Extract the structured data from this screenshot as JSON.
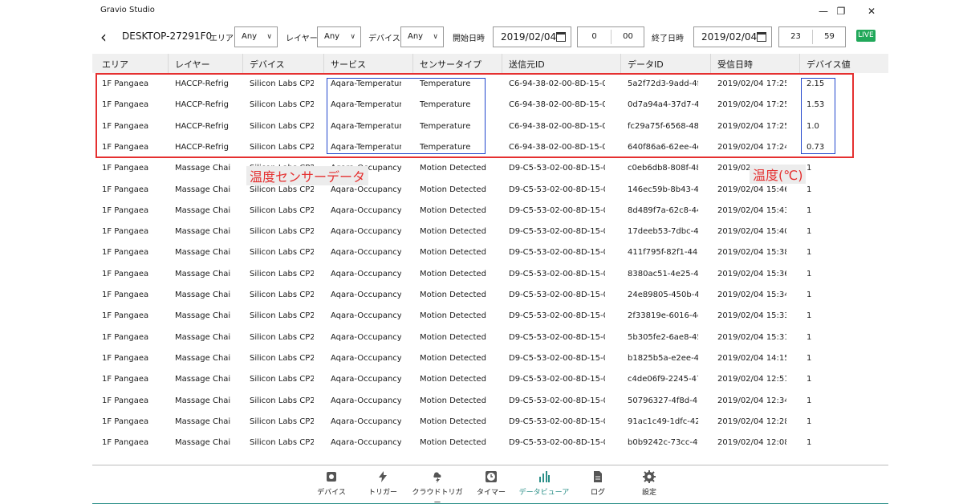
{
  "app": {
    "title": "Gravio Studio"
  },
  "toolbar": {
    "device_name": "DESKTOP-27291F0",
    "area_label": "エリア",
    "area_value": "Any",
    "layer_label": "レイヤー",
    "layer_value": "Any",
    "device_label": "デバイス",
    "device_value": "Any",
    "start_label": "開始日時",
    "start_date": "2019/02/04",
    "start_hour": "0",
    "start_minute": "00",
    "end_label": "終了日時",
    "end_date": "2019/02/04",
    "end_hour": "23",
    "end_minute": "59",
    "live_label": "LIVE"
  },
  "table": {
    "headers": [
      "エリア",
      "レイヤー",
      "デバイス",
      "サービス",
      "センサータイプ",
      "送信元ID",
      "データID",
      "受信日時",
      "デバイス値"
    ],
    "rows": [
      [
        "1F Pangaea",
        "HACCP-Refrig",
        "Silicon Labs CP2",
        "Aqara-Temperatur",
        "Temperature",
        "C6-94-38-02-00-8D-15-0(",
        "5a2f72d3-9add-4f",
        "2019/02/04 17:25:",
        "2.15"
      ],
      [
        "1F Pangaea",
        "HACCP-Refrig",
        "Silicon Labs CP2",
        "Aqara-Temperatur",
        "Temperature",
        "C6-94-38-02-00-8D-15-0(",
        "0d7a94a4-37d7-4",
        "2019/02/04 17:25:",
        "1.53"
      ],
      [
        "1F Pangaea",
        "HACCP-Refrig",
        "Silicon Labs CP2",
        "Aqara-Temperatur",
        "Temperature",
        "C6-94-38-02-00-8D-15-0(",
        "fc29a75f-6568-48",
        "2019/02/04 17:25:",
        "1.0"
      ],
      [
        "1F Pangaea",
        "HACCP-Refrig",
        "Silicon Labs CP2",
        "Aqara-Temperatur",
        "Temperature",
        "C6-94-38-02-00-8D-15-0(",
        "640f86a6-62ee-4e",
        "2019/02/04 17:24:",
        "0.73"
      ],
      [
        "1F Pangaea",
        "Massage Chai",
        "Silicon Labs CP2",
        "Aqara-Occupancy",
        "Motion Detected",
        "D9-C5-53-02-00-8D-15-0",
        "c0eb6db8-808f-48",
        "2019/02/0",
        "1"
      ],
      [
        "1F Pangaea",
        "Massage Chai",
        "Silicon Labs CP2",
        "Aqara-Occupancy",
        "Motion Detected",
        "D9-C5-53-02-00-8D-15-0",
        "146ec59b-8b43-4",
        "2019/02/04 15:46:",
        "1"
      ],
      [
        "1F Pangaea",
        "Massage Chai",
        "Silicon Labs CP2",
        "Aqara-Occupancy",
        "Motion Detected",
        "D9-C5-53-02-00-8D-15-0",
        "8d489f7a-62c8-44",
        "2019/02/04 15:43:",
        "1"
      ],
      [
        "1F Pangaea",
        "Massage Chai",
        "Silicon Labs CP2",
        "Aqara-Occupancy",
        "Motion Detected",
        "D9-C5-53-02-00-8D-15-0",
        "17deeb53-7dbc-4",
        "2019/02/04 15:40:",
        "1"
      ],
      [
        "1F Pangaea",
        "Massage Chai",
        "Silicon Labs CP2",
        "Aqara-Occupancy",
        "Motion Detected",
        "D9-C5-53-02-00-8D-15-0",
        "411f795f-82f1-44",
        "2019/02/04 15:38:",
        "1"
      ],
      [
        "1F Pangaea",
        "Massage Chai",
        "Silicon Labs CP2",
        "Aqara-Occupancy",
        "Motion Detected",
        "D9-C5-53-02-00-8D-15-0",
        "8380ac51-4e25-4f",
        "2019/02/04 15:36:",
        "1"
      ],
      [
        "1F Pangaea",
        "Massage Chai",
        "Silicon Labs CP2",
        "Aqara-Occupancy",
        "Motion Detected",
        "D9-C5-53-02-00-8D-15-0",
        "24e89805-450b-4",
        "2019/02/04 15:34:",
        "1"
      ],
      [
        "1F Pangaea",
        "Massage Chai",
        "Silicon Labs CP2",
        "Aqara-Occupancy",
        "Motion Detected",
        "D9-C5-53-02-00-8D-15-0",
        "2f33819e-6016-4c",
        "2019/02/04 15:33:",
        "1"
      ],
      [
        "1F Pangaea",
        "Massage Chai",
        "Silicon Labs CP2",
        "Aqara-Occupancy",
        "Motion Detected",
        "D9-C5-53-02-00-8D-15-0",
        "5b305fe2-6ae8-45",
        "2019/02/04 15:31:",
        "1"
      ],
      [
        "1F Pangaea",
        "Massage Chai",
        "Silicon Labs CP2",
        "Aqara-Occupancy",
        "Motion Detected",
        "D9-C5-53-02-00-8D-15-0",
        "b1825b5a-e2ee-4",
        "2019/02/04 14:15:",
        "1"
      ],
      [
        "1F Pangaea",
        "Massage Chai",
        "Silicon Labs CP2",
        "Aqara-Occupancy",
        "Motion Detected",
        "D9-C5-53-02-00-8D-15-0",
        "c4de06f9-2245-47",
        "2019/02/04 12:51:",
        "1"
      ],
      [
        "1F Pangaea",
        "Massage Chai",
        "Silicon Labs CP2",
        "Aqara-Occupancy",
        "Motion Detected",
        "D9-C5-53-02-00-8D-15-0",
        "50796327-4f8d-4(",
        "2019/02/04 12:34:",
        "1"
      ],
      [
        "1F Pangaea",
        "Massage Chai",
        "Silicon Labs CP2",
        "Aqara-Occupancy",
        "Motion Detected",
        "D9-C5-53-02-00-8D-15-0",
        "91ac1c49-1dfc-42",
        "2019/02/04 12:28:",
        "1"
      ],
      [
        "1F Pangaea",
        "Massage Chai",
        "Silicon Labs CP2",
        "Aqara-Occupancy",
        "Motion Detected",
        "D9-C5-53-02-00-8D-15-0",
        "b0b9242c-73cc-4f",
        "2019/02/04 12:08:",
        "1"
      ]
    ]
  },
  "annotations": {
    "sensor_data": "温度センサーデータ",
    "temperature_unit": "温度(℃)"
  },
  "nav": {
    "items": [
      {
        "label": "デバイス",
        "icon": "gear-device-icon"
      },
      {
        "label": "トリガー",
        "icon": "lightning-icon"
      },
      {
        "label": "クラウドトリガー",
        "icon": "cloud-lightning-icon"
      },
      {
        "label": "タイマー",
        "icon": "clock-icon"
      },
      {
        "label": "データビューア",
        "icon": "bar-chart-icon"
      },
      {
        "label": "ログ",
        "icon": "document-icon"
      },
      {
        "label": "設定",
        "icon": "gear-icon"
      }
    ],
    "active": "データビューア"
  },
  "colors": {
    "highlight_red": "#e53030",
    "highlight_blue": "#2045cc",
    "live_green": "#21a85a",
    "accent_teal": "#2b8f88"
  }
}
